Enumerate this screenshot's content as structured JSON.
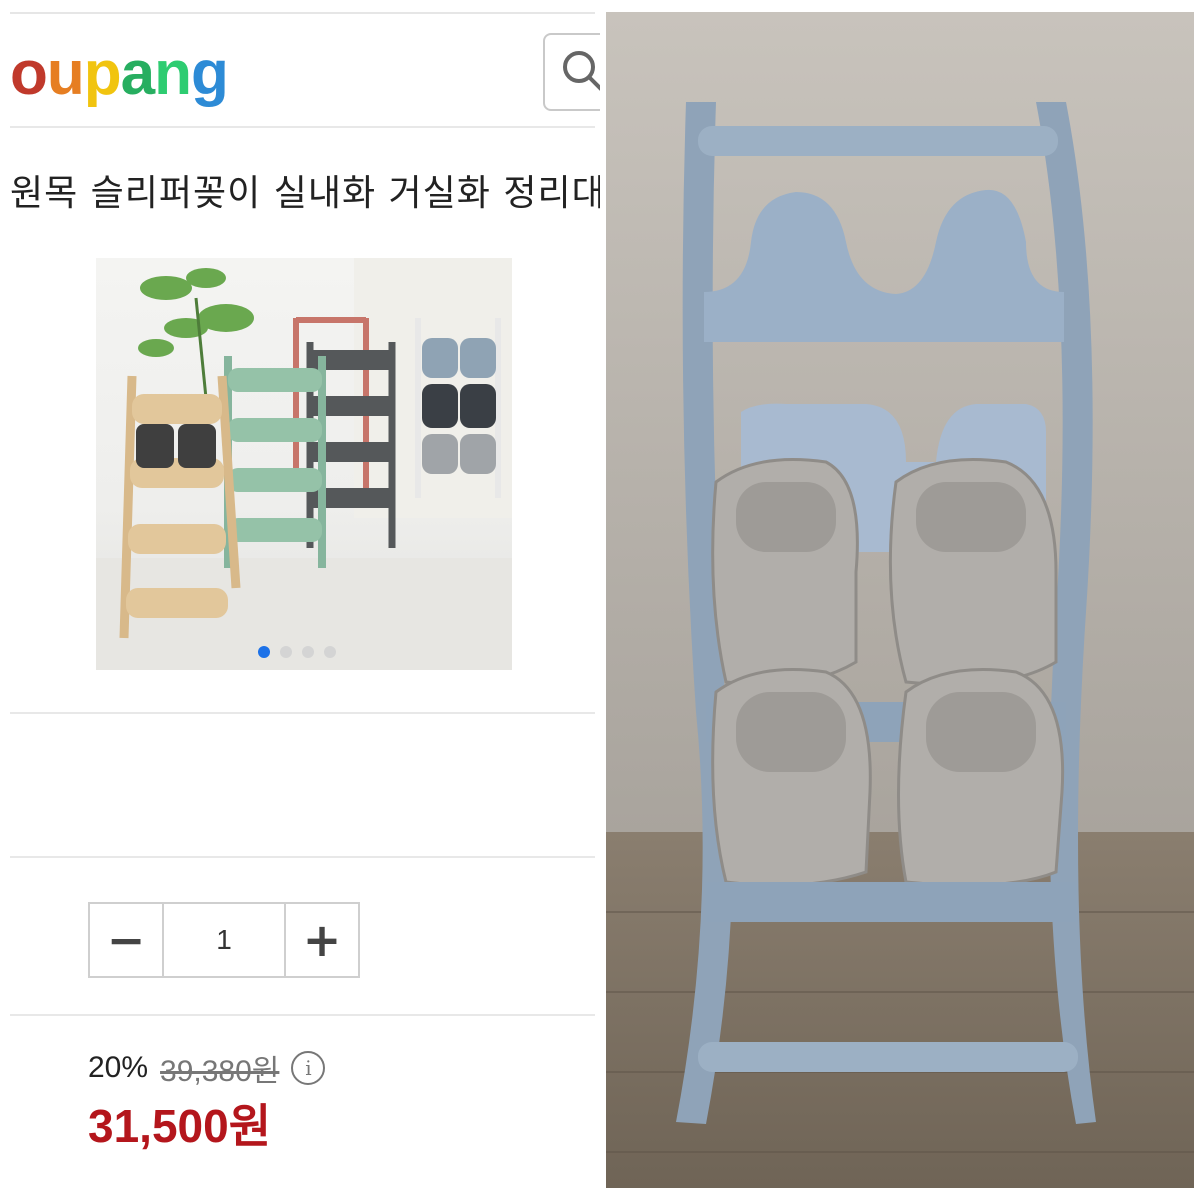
{
  "header": {
    "logo_letters": [
      {
        "ch": "o",
        "color": "#c0392b"
      },
      {
        "ch": "u",
        "color": "#e67e22"
      },
      {
        "ch": "p",
        "color": "#f1c40f"
      },
      {
        "ch": "a",
        "color": "#27ae60"
      },
      {
        "ch": "n",
        "color": "#2ecc71"
      },
      {
        "ch": "g",
        "color": "#2d8bd6"
      }
    ],
    "search_icon": "search-icon"
  },
  "product": {
    "title": "원목 슬리퍼꽂이 실내화 거실화 정리대",
    "image_dots": 4,
    "active_dot": 0
  },
  "quantity": {
    "minus_label": "−",
    "value": "1",
    "plus_label": "+"
  },
  "price": {
    "discount": "20%",
    "original": "39,380원",
    "info_label": "i",
    "sale": "31,500원"
  },
  "colors": {
    "accent_blue": "#1d72e8",
    "sale_red": "#b4161c"
  }
}
